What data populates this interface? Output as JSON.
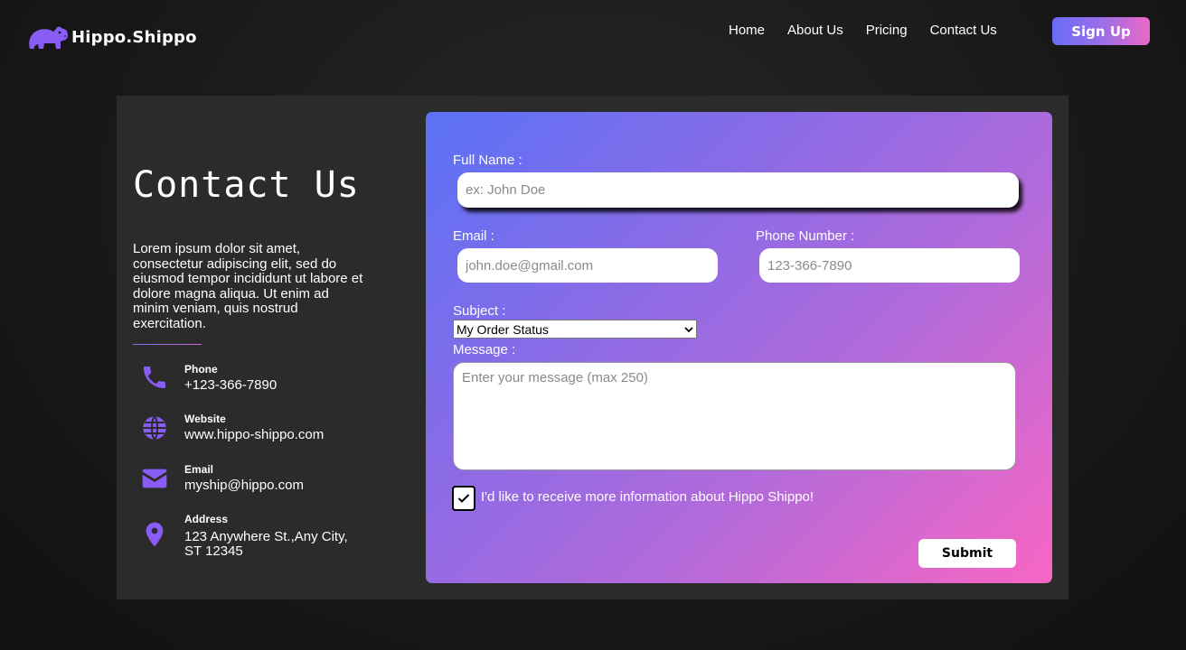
{
  "brand": {
    "name": "Hippo.Shippo",
    "accent": "#8a5cf6",
    "icon": "hippo-logo-icon"
  },
  "nav": {
    "links": [
      "Home",
      "About Us",
      "Pricing",
      "Contact Us"
    ],
    "signup_label": "Sign Up"
  },
  "contact": {
    "title": "Contact Us",
    "description": "Lorem ipsum dolor sit amet, consectetur adipiscing elit, sed do eiusmod tempor incididunt ut labore et dolore magna aliqua. Ut enim ad minim veniam, quis nostrud exercitation.",
    "items": [
      {
        "icon": "phone-icon",
        "label": "Phone",
        "value": "+123-366-7890"
      },
      {
        "icon": "globe-icon",
        "label": "Website",
        "value": "www.hippo-shippo.com"
      },
      {
        "icon": "envelope-icon",
        "label": "Email",
        "value": "myship@hippo.com"
      },
      {
        "icon": "location-pin-icon",
        "label": "Address",
        "value": "123 Anywhere St.,Any City, ST 12345"
      }
    ]
  },
  "form": {
    "full_name": {
      "label": "Full Name :",
      "placeholder": "ex: John Doe"
    },
    "email": {
      "label": "Email :",
      "placeholder": "john.doe@gmail.com"
    },
    "phone": {
      "label": "Phone Number :",
      "placeholder": "123-366-7890"
    },
    "subject": {
      "label": "Subject :",
      "selected": "My Order Status"
    },
    "message": {
      "label": "Message :",
      "placeholder": "Enter your message (max 250)"
    },
    "opt_in": {
      "label": "I'd like to receive more information about Hippo Shippo!",
      "checked": true
    },
    "submit_label": "Submit"
  }
}
